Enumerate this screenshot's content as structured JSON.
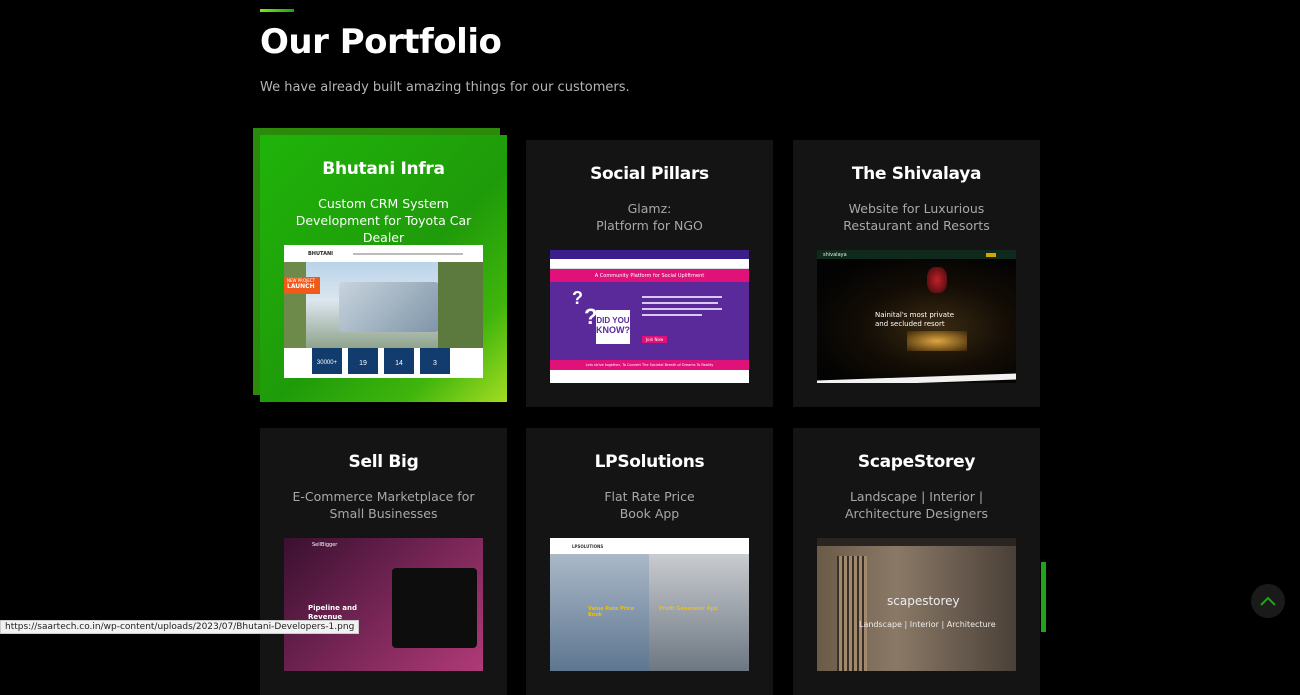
{
  "header": {
    "title": "Our Portfolio",
    "subtitle": "We have already built amazing things for our customers."
  },
  "cards": [
    {
      "title": "Bhutani Infra",
      "desc": "Custom CRM System Development for Toyota Car Dealer",
      "active": true
    },
    {
      "title": "Social Pillars",
      "desc": "Glamz:\nPlatform for NGO",
      "active": false
    },
    {
      "title": "The Shivalaya",
      "desc": "Website for Luxurious Restaurant and Resorts",
      "active": false
    },
    {
      "title": "Sell Big",
      "desc": "E-Commerce Marketplace for Small Businesses",
      "active": false
    },
    {
      "title": "LPSolutions",
      "desc": "Flat Rate Price\nBook App",
      "active": false
    },
    {
      "title": "ScapeStorey",
      "desc": "Landscape | Interior | Architecture Designers",
      "active": false
    }
  ],
  "thumbs": {
    "bhutani": {
      "logo": "BHUTANI",
      "badge_top": "NEW PROJECT",
      "badge_main": "LAUNCH",
      "stat1": "30000+",
      "stat2": "19",
      "stat3": "14",
      "stat4": "3"
    },
    "social": {
      "banner": "A Community Platform for Social Upliftment",
      "did": "DID YOU",
      "know": "KNOW?",
      "cta": "Join Now",
      "footer": "Lets strive together, To Convert The Societal Breath of Dreams To Reality"
    },
    "shivalaya": {
      "brand": "shivalaya",
      "tagline": "Nainital's most private and secluded resort"
    },
    "sellbig": {
      "brand": "SellBigger",
      "headline": "Pipeline and Revenue Growth"
    },
    "lps": {
      "brand": "LPSOLUTIONS",
      "left": "Value Rate Price Book",
      "right": "Profit Generator App"
    },
    "scape": {
      "brand": "scapestorey",
      "tagline": "Landscape | Interior | Architecture"
    }
  },
  "status_url": "https://saartech.co.in/wp-content/uploads/2023/07/Bhutani-Developers-1.png",
  "colors": {
    "accent": "#1fa51a",
    "card_bg": "#141414",
    "background": "#000000"
  },
  "icons": {
    "scroll_top": "chevron-up-icon"
  }
}
